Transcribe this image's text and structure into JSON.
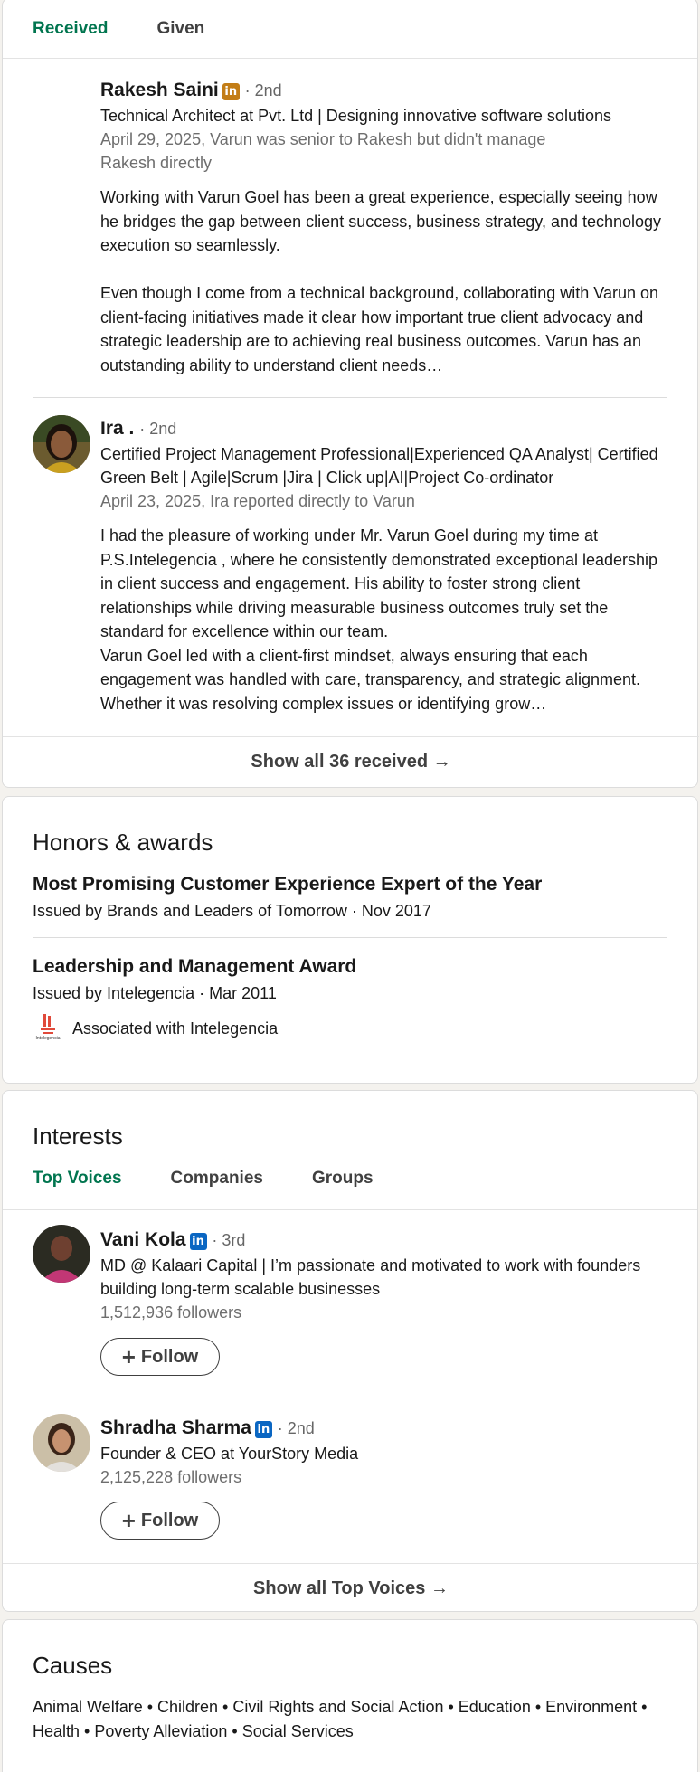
{
  "rec_tabs": {
    "received": "Received",
    "given": "Given"
  },
  "recommendations": [
    {
      "name": "Rakesh Saini",
      "degree": "· 2nd",
      "badge": "in",
      "headline": "Technical Architect at Pvt. Ltd | Designing innovative software solutions",
      "meta": "April 29, 2025, Varun was senior to Rakesh but didn't manage Rakesh directly",
      "text": "Working with Varun Goel has been a great experience, especially seeing how he bridges the gap between client success, business strategy, and technology execution so seamlessly.\n\nEven though I come from a technical background, collaborating with Varun on client-facing initiatives made it clear how important true client advocacy and strategic leadership are to achieving real business outcomes. Varun has an outstanding ability to understand client needs…"
    },
    {
      "name": "Ira .",
      "degree": "· 2nd",
      "headline": "Certified Project Management Professional|Experienced QA Analyst| Certified Green Belt | Agile|Scrum |Jira | Click up|AI|Project Co-ordinator",
      "meta": "April 23, 2025, Ira reported directly to Varun",
      "text": "I had the pleasure of working under Mr. Varun Goel during my time at P.S.Intelegencia , where he consistently demonstrated exceptional leadership in client success and engagement. His ability to foster strong client relationships while driving measurable business outcomes truly set the standard for excellence within our team.\nVarun Goel led with a client-first mindset, always ensuring that each engagement was handled with care, transparency, and strategic alignment. Whether it was resolving complex issues or identifying grow…"
    }
  ],
  "rec_show_all": "Show all 36 received →",
  "honors": {
    "title": "Honors & awards",
    "items": [
      {
        "title": "Most Promising Customer Experience Expert of the Year",
        "meta": "Issued by Brands and Leaders of Tomorrow · Nov 2017"
      },
      {
        "title": "Leadership and Management Award",
        "meta": "Issued by Intelegencia · Mar 2011",
        "associated": "Associated with Intelegencia",
        "logo_text": "Intelegencia"
      }
    ]
  },
  "interests": {
    "title": "Interests",
    "tabs": [
      "Top Voices",
      "Companies",
      "Groups"
    ],
    "people": [
      {
        "name": "Vani Kola",
        "badge": "in",
        "degree": "· 3rd",
        "headline": "MD @ Kalaari Capital | I’m passionate and motivated to work with founders building long-term scalable businesses",
        "followers": "1,512,936 followers",
        "follow_label": "Follow"
      },
      {
        "name": "Shradha Sharma",
        "badge": "in",
        "degree": "· 2nd",
        "headline": "Founder & CEO at YourStory Media",
        "followers": "2,125,228 followers",
        "follow_label": "Follow"
      }
    ],
    "show_all": "Show all Top Voices →"
  },
  "causes": {
    "title": "Causes",
    "text": "Animal Welfare • Children • Civil Rights and Social Action • Education • Environment • Health • Poverty Alleviation • Social Services"
  },
  "colors": {
    "accent": "#01754f",
    "linkedin_blue": "#0a66c2",
    "badge_gold": "#c37d16"
  }
}
